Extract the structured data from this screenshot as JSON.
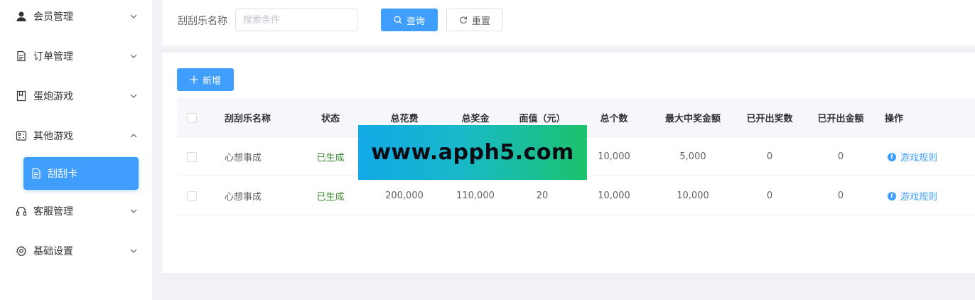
{
  "sidebar": {
    "items": [
      {
        "label": "会员管理",
        "icon": "user-icon",
        "expanded": false
      },
      {
        "label": "订单管理",
        "icon": "document-icon",
        "expanded": false
      },
      {
        "label": "蛋炮游戏",
        "icon": "bookmark-icon",
        "expanded": false
      },
      {
        "label": "其他游戏",
        "icon": "gamepad-icon",
        "expanded": true
      },
      {
        "label": "客服管理",
        "icon": "headset-icon",
        "expanded": false
      },
      {
        "label": "基础设置",
        "icon": "gear-icon",
        "expanded": false
      }
    ],
    "subitem": {
      "label": "刮刮卡",
      "icon": "document-icon",
      "active": true
    }
  },
  "search": {
    "label": "刮刮乐名称",
    "placeholder": "搜索条件",
    "value": "",
    "query_label": "查询",
    "reset_label": "重置"
  },
  "toolbar": {
    "add_label": "新增"
  },
  "table": {
    "headers": [
      "刮刮乐名称",
      "状态",
      "总花费",
      "总奖金",
      "面值（元）",
      "总个数",
      "最大中奖金额",
      "已开出奖数",
      "已开出金额",
      "操作"
    ],
    "rows": [
      {
        "name": "心想事成",
        "status": "已生成",
        "total_cost": "",
        "total_prize": "",
        "face_value": "",
        "total_count": "10,000",
        "max_prize": "5,000",
        "opened_count": "0",
        "opened_amount": "0",
        "action": "游戏规则"
      },
      {
        "name": "心想事成",
        "status": "已生成",
        "total_cost": "200,000",
        "total_prize": "110,000",
        "face_value": "20",
        "total_count": "10,000",
        "max_prize": "10,000",
        "opened_count": "0",
        "opened_amount": "0",
        "action": "游戏规则"
      }
    ]
  },
  "watermark": {
    "text": "www.apph5.com"
  },
  "colors": {
    "primary": "#409eff",
    "success_text": "#3a8a2f",
    "watermark_start": "#12a9e6",
    "watermark_end": "#1cc26c"
  }
}
